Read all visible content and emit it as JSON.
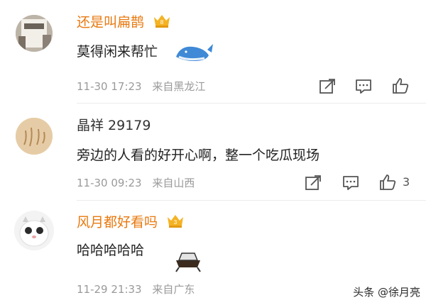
{
  "comments": [
    {
      "user": "还是叫扁鹊",
      "text": "莫得闲来帮忙",
      "time": "11-30 17:23",
      "location": "来自黑龙江",
      "likes": ""
    },
    {
      "user": "晶祥 29179",
      "text": "旁边的人看的好开心啊，整一个吃瓜现场",
      "time": "11-30 09:23",
      "location": "来自山西",
      "likes": "3"
    },
    {
      "user": "风月都好看吗",
      "text": "哈哈哈哈哈",
      "time": "11-29 21:33",
      "location": "来自广东",
      "likes": ""
    }
  ],
  "watermark": "头条 @徐月亮",
  "colors": {
    "vip_name": "#e9790f",
    "plain_name": "#333333",
    "meta": "#9a9a9a",
    "divider": "#ececec",
    "badge": "#f5b323"
  },
  "icons": [
    "vip-badge-icon",
    "repost-icon",
    "reply-icon",
    "like-icon",
    "whale-sticker",
    "melon-sticker"
  ]
}
